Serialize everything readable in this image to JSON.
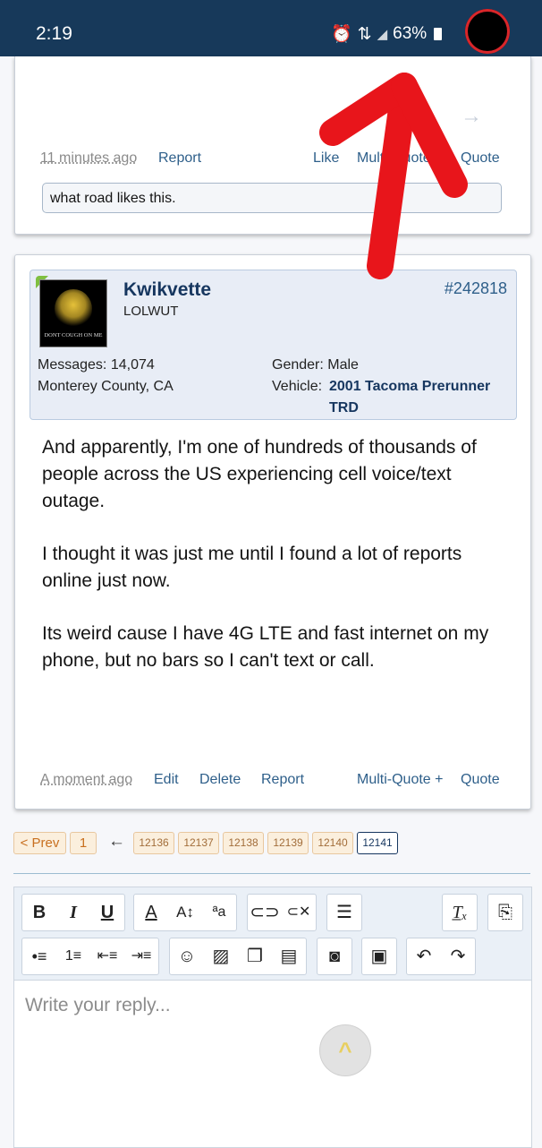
{
  "status_bar": {
    "time": "2:19",
    "alarm_icon": "alarm-icon",
    "data_icon": "data-icon",
    "signal_icon": "signal-icon",
    "battery": "63%"
  },
  "post1": {
    "time": "11 minutes ago",
    "report": "Report",
    "like": "Like",
    "multi_quote": "Multi-Quote",
    "quote": "Quote",
    "reply_text": "what road likes this."
  },
  "post2": {
    "username": "Kwikvette",
    "user_title": "LOLWUT",
    "post_number": "#242818",
    "avatar_motto": "DONT COUGH ON ME",
    "messages_label": "Messages:",
    "messages_value": "14,074",
    "location": "Monterey County, CA",
    "gender_label": "Gender:",
    "gender_value": "Male",
    "vehicle_label": "Vehicle:",
    "vehicle_line1": "2001 Tacoma Prerunner",
    "vehicle_line2": "TRD",
    "body": [
      "And apparently, I'm one of hundreds of thousands of people across the US experiencing cell voice/text outage.",
      "I thought it was just me until I found a lot of reports online just now.",
      "Its weird cause I have 4G LTE and fast internet on my phone, but no bars so I can't text or call."
    ],
    "time": "A moment ago",
    "edit": "Edit",
    "delete": "Delete",
    "report": "Report",
    "multi_quote": "Multi-Quote +",
    "quote": "Quote"
  },
  "pager": {
    "prev": "< Prev",
    "first": "1",
    "arrow": "←",
    "pages": [
      "12136",
      "12137",
      "12138",
      "12139",
      "12140",
      "12141"
    ],
    "current": "12141"
  },
  "editor": {
    "placeholder": "Write your reply...",
    "toolbar_row1": [
      "bold-icon",
      "italic-icon",
      "underline-icon",
      "text-color-icon",
      "font-size-icon",
      "font-family-icon",
      "link-icon",
      "unlink-icon",
      "align-icon",
      "clear-format-icon",
      "toggle-bbcode-icon"
    ],
    "toolbar_row2": [
      "bullet-list-icon",
      "number-list-icon",
      "outdent-icon",
      "indent-icon",
      "smilie-icon",
      "image-icon",
      "media-icon",
      "insert-icon",
      "camera-icon",
      "save-draft-icon",
      "undo-icon",
      "redo-icon"
    ]
  },
  "colors": {
    "status_bar": "#17395a",
    "link": "#2e5f8a",
    "username": "#16365f",
    "annotation_arrow": "#e8151b"
  }
}
